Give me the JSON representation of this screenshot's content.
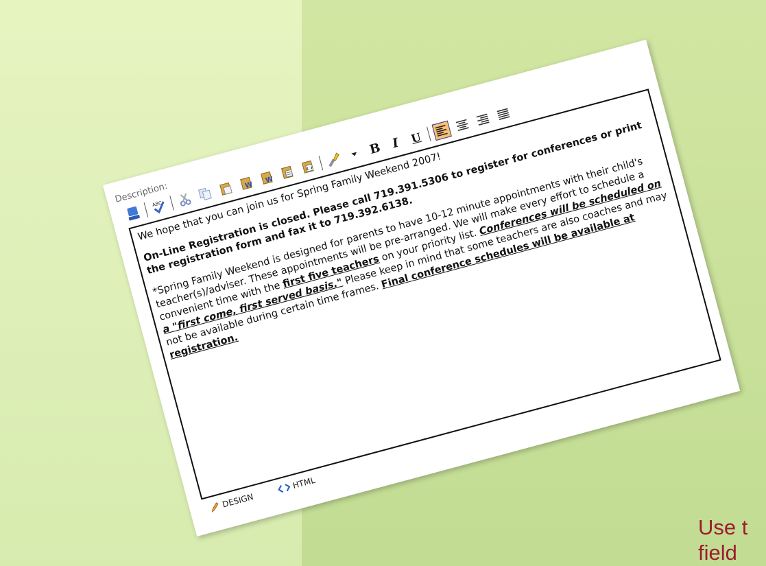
{
  "editor": {
    "label": "Description:",
    "toolbar": {
      "bold": "B",
      "italic": "I",
      "underline": "U"
    },
    "content": {
      "line1": "We hope that you can join us for Spring Family Weekend 2007!",
      "para2": "On-Line Registration is closed.  Please call 719.391.5306 to register for conferences or print the registration form and fax it to 719.392.6138.",
      "para3_a": "*Spring Family Weekend is designed for parents to have 10-12 minute appointments with their child's teacher(s)/adviser. These appointments will be pre-arranged. We will make every effort to schedule a convenient time with the ",
      "para3_b": "first five teachers",
      "para3_c": " on your priority list. ",
      "para3_d": "Conferences will be scheduled on a \"first come, first served basis.\"",
      "para3_e": " Please keep in mind that some teachers are also coaches and may not be available during certain time frames. ",
      "para3_f": "Final conference schedules will be available at registration."
    },
    "modes": {
      "design": "DESIGN",
      "html": "HTML"
    }
  },
  "side_text": {
    "line1": "Use t",
    "line2": "field"
  },
  "colors": {
    "side_text": "#9b1d2f",
    "active_button": "#fbc075"
  }
}
